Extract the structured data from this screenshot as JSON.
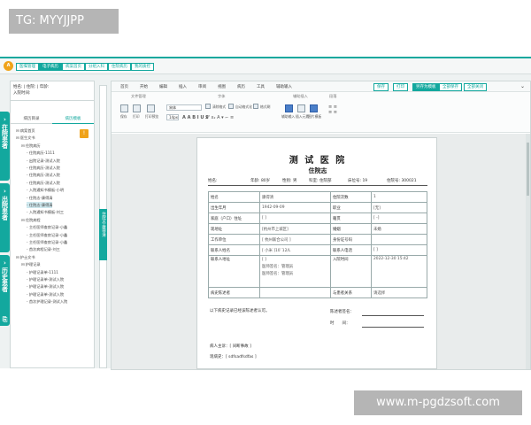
{
  "watermarks": {
    "top": "TG: MYYJJPP",
    "bottom": "www.m-pgdzsoft.com"
  },
  "topnav": {
    "logo": "A",
    "items": [
      "医嘱管理",
      "电子病历",
      "病案首页",
      "分组入科",
      "住院病历",
      "我的质控"
    ],
    "active_index": 1
  },
  "sidebar_tabs": [
    "在院患者",
    "出院患者",
    "历史患者"
  ],
  "patient": {
    "line1": "姓名: | 住院: | 年龄:",
    "line2": "入院时间:"
  },
  "left_tabs": [
    "病历目录",
    "病历模板"
  ],
  "tree": [
    {
      "label": "病案首页",
      "indent": 0
    },
    {
      "label": "医生文书",
      "indent": 0
    },
    {
      "label": "住院病历",
      "indent": 1
    },
    {
      "label": "住院病历-1111",
      "indent": 2
    },
    {
      "label": "出院记录-测试入院",
      "indent": 2
    },
    {
      "label": "住院病历-测试入院",
      "indent": 2
    },
    {
      "label": "住院病历-测试入院",
      "indent": 2
    },
    {
      "label": "住院病历-测试入院",
      "indent": 2
    },
    {
      "label": "入院通知书模板-小明",
      "indent": 2
    },
    {
      "label": "住院志-康得清",
      "indent": 2
    },
    {
      "label": "住院志-康得清",
      "indent": 2
    },
    {
      "label": "入院通知书模板-刘三",
      "indent": 2
    },
    {
      "label": "住院病程",
      "indent": 1
    },
    {
      "label": "主任医师查房记录-小鑫",
      "indent": 2
    },
    {
      "label": "主任医师查房记录-小鑫",
      "indent": 2
    },
    {
      "label": "主任医师查房记录-小鑫",
      "indent": 2
    },
    {
      "label": "首次病程记录-刘三",
      "indent": 2
    },
    {
      "label": "护士文书",
      "indent": 0
    },
    {
      "label": "护理记录",
      "indent": 1
    },
    {
      "label": "护理记录单-1111",
      "indent": 2
    },
    {
      "label": "护理记录单-测试入院",
      "indent": 2
    },
    {
      "label": "护理记录单-测试入院",
      "indent": 2
    },
    {
      "label": "护理记录单-测试入院",
      "indent": 2
    },
    {
      "label": "首次护理记录-测试入院",
      "indent": 2
    }
  ],
  "tree_selected": 10,
  "vstrip_label": "住院志-康得清",
  "menu": [
    "首页",
    "开始",
    "编辑",
    "插入",
    "审阅",
    "视图",
    "病历",
    "工具",
    "辅助输入"
  ],
  "actions": [
    "保存",
    "打印",
    "另存为模板",
    "全部保存",
    "全部关闭"
  ],
  "ribbon": {
    "groups": [
      "文件管理",
      "字体",
      "辅助插入",
      "段落"
    ],
    "buttons": [
      "保存",
      "打印",
      "打印预览",
      "清除格式",
      "自动格式化",
      "格式刷",
      "辅助输入",
      "插入元素",
      "图片模板"
    ],
    "font": "宋体",
    "size": "14px"
  },
  "document": {
    "hospital": "测 试 医 院",
    "title": "住院志",
    "header": {
      "name": "姓名:",
      "age": "年龄: 80岁",
      "sex": "性别: 男",
      "dept": "科室: 住院部",
      "bed": "床位号: 19",
      "inpatient_no": "住院号: 300021"
    },
    "rows": [
      [
        "姓名",
        "康得清",
        "住院次数",
        "1"
      ],
      [
        "出生年月",
        "1942-09-09",
        "职业",
        "[无]"
      ],
      [
        "家庭（户口）住址",
        "[ ]",
        "籍贯",
        "[        -]"
      ],
      [
        "现地址",
        "[杭州市上城区]",
        "婚姻",
        "未婚"
      ],
      [
        "工作单位",
        "[ 杭州联合公司 ]",
        "身份证号码",
        ""
      ],
      [
        "联系人姓名",
        "[ 小米 ]10`12/L",
        "联系人电话",
        "[ ]"
      ]
    ],
    "contact_address_label": "联系人地址",
    "contact_address_value": "[ ]",
    "doctor_sign": "医师签名：管理员",
    "doctor_sign2": "医师签名：管理员",
    "admit_time_label": "入院时间",
    "admit_time_value": "2022-12-30 15:42",
    "narrator_label": "病史陈述者",
    "relation_label": "与患者关系",
    "relation_value": "请选择",
    "confirm": "以下病史记录已经该陈述者认可。",
    "narrator_sign": "陈述者签名：",
    "time": "时　　间：",
    "complaint": "病人主诉：[ 间断事故 ]",
    "history": "现病史：[ sdfsadfsdfas ]"
  }
}
